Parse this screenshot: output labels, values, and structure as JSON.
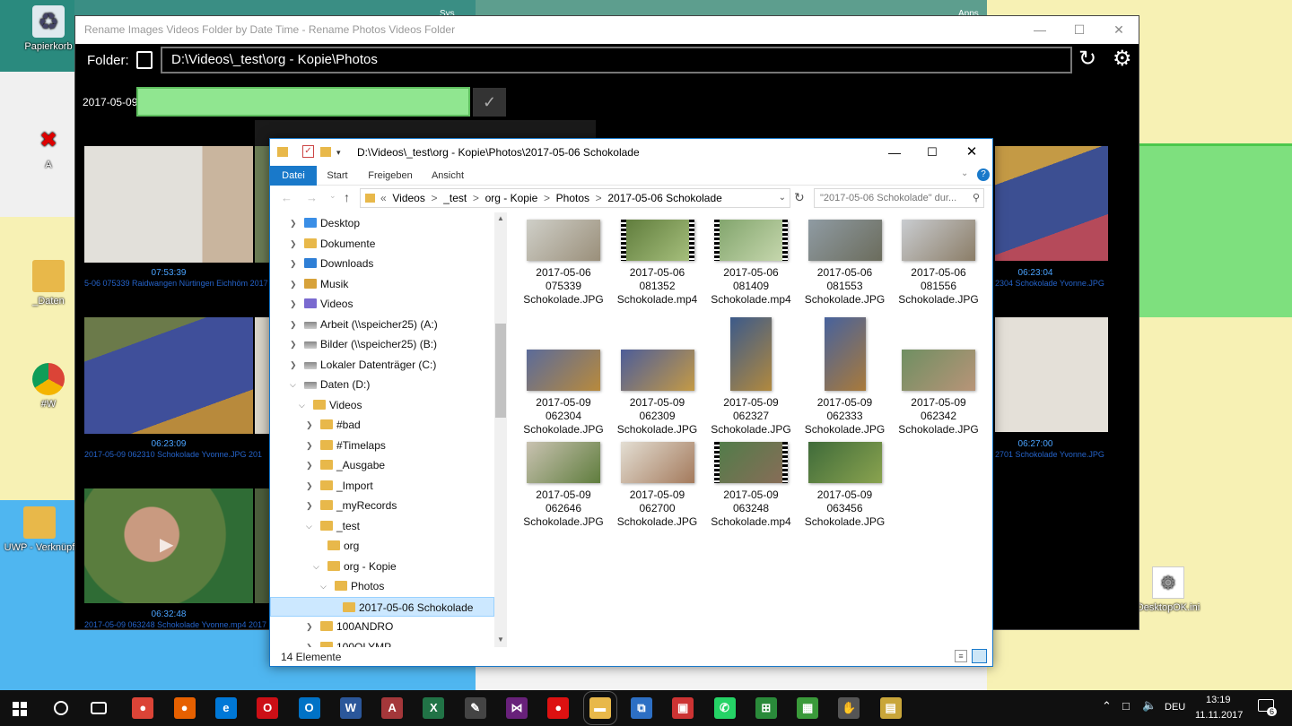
{
  "desktop": {
    "icons": [
      {
        "label": "Papierkorb",
        "icon": "recycle-bin-icon",
        "glyph": "🗑"
      },
      {
        "label": "A",
        "icon": "disconnected-drive-icon",
        "glyph": "🖥"
      },
      {
        "label": "_Daten",
        "icon": "folder-shortcut-icon",
        "glyph": "📁"
      },
      {
        "label": "#W",
        "icon": "chrome-shortcut-icon",
        "glyph": "🌐"
      },
      {
        "label": "UWP - Verknüpf",
        "icon": "folder-shortcut-icon",
        "glyph": "📁"
      },
      {
        "label": "DesktopOK.ini",
        "icon": "settings-file-icon",
        "glyph": "⚙"
      }
    ],
    "tile_text": [
      "Sys",
      "Apps"
    ]
  },
  "app": {
    "title": "Rename Images Videos Folder by Date Time - Rename Photos Videos Folder",
    "folder_label": "Folder:",
    "folder_path": "D:\\Videos\\_test\\org - Kopie\\Photos",
    "date_label": "2017-05-09",
    "confirm_glyph": "✓",
    "refresh_glyph": "↻",
    "settings_glyph": "⚙",
    "thumbs": [
      {
        "time": "07:53:39",
        "name": "5-06 075339 Raidwangen Nürtingen Eichhöm 2017-"
      },
      {
        "time": "06:23:04",
        "name": "2304 Schokolade Yvonne.JPG"
      },
      {
        "time": "06:23:09",
        "name": "2017-05-09 062310 Schokolade Yvonne.JPG 201"
      },
      {
        "time": "06:27:00",
        "name": "2701 Schokolade Yvonne.JPG"
      },
      {
        "time": "06:32:48",
        "name": "2017-05-09 063248 Schokolade Yvonne.mp4 2017"
      }
    ]
  },
  "explorer": {
    "title_path": "D:\\Videos\\_test\\org - Kopie\\Photos\\2017-05-06 Schokolade",
    "tabs": [
      "Datei",
      "Start",
      "Freigeben",
      "Ansicht"
    ],
    "breadcrumb": [
      "«",
      "Videos",
      ">",
      "_test",
      ">",
      "org - Kopie",
      ">",
      "Photos",
      ">",
      "2017-05-06 Schokolade"
    ],
    "search_placeholder": "\"2017-05-06 Schokolade\" dur...",
    "status": "14 Elemente",
    "tree": [
      {
        "label": "Desktop",
        "indent": 0,
        "chev": ">",
        "icon": "desktop"
      },
      {
        "label": "Dokumente",
        "indent": 0,
        "chev": ">",
        "icon": "docs"
      },
      {
        "label": "Downloads",
        "indent": 0,
        "chev": ">",
        "icon": "down"
      },
      {
        "label": "Musik",
        "indent": 0,
        "chev": ">",
        "icon": "music"
      },
      {
        "label": "Videos",
        "indent": 0,
        "chev": ">",
        "icon": "video"
      },
      {
        "label": "Arbeit (\\\\speicher25) (A:)",
        "indent": 0,
        "chev": ">",
        "icon": "drive"
      },
      {
        "label": "Bilder (\\\\speicher25) (B:)",
        "indent": 0,
        "chev": ">",
        "icon": "drive"
      },
      {
        "label": "Lokaler Datenträger (C:)",
        "indent": 0,
        "chev": ">",
        "icon": "drive"
      },
      {
        "label": "Daten (D:)",
        "indent": 0,
        "chev": "v",
        "icon": "drive"
      },
      {
        "label": "Videos",
        "indent": 1,
        "chev": "v",
        "icon": "folder"
      },
      {
        "label": "#bad",
        "indent": 2,
        "chev": ">",
        "icon": "folder"
      },
      {
        "label": "#Timelaps",
        "indent": 2,
        "chev": ">",
        "icon": "folder"
      },
      {
        "label": "_Ausgabe",
        "indent": 2,
        "chev": ">",
        "icon": "folder"
      },
      {
        "label": "_Import",
        "indent": 2,
        "chev": ">",
        "icon": "folder"
      },
      {
        "label": "_myRecords",
        "indent": 2,
        "chev": ">",
        "icon": "folder"
      },
      {
        "label": "_test",
        "indent": 2,
        "chev": "v",
        "icon": "folder"
      },
      {
        "label": "org",
        "indent": 3,
        "chev": "",
        "icon": "folder"
      },
      {
        "label": "org - Kopie",
        "indent": 3,
        "chev": "v",
        "icon": "folder"
      },
      {
        "label": "Photos",
        "indent": 4,
        "chev": "v",
        "icon": "folder"
      },
      {
        "label": "2017-05-06 Schokolade",
        "indent": 5,
        "chev": "",
        "icon": "folder",
        "selected": true
      },
      {
        "label": "100ANDRO",
        "indent": 2,
        "chev": ">",
        "icon": "folder"
      },
      {
        "label": "100OLYMP",
        "indent": 2,
        "chev": ">",
        "icon": "folder"
      }
    ],
    "files": [
      {
        "l1": "2017-05-06",
        "l2": "075339",
        "l3": "Schokolade.JPG",
        "kind": "img",
        "c1": "#cfcfc8",
        "c2": "#9a8f7a"
      },
      {
        "l1": "2017-05-06",
        "l2": "081352",
        "l3": "Schokolade.mp4",
        "kind": "vid",
        "c1": "#5d7a3a",
        "c2": "#a9c27f"
      },
      {
        "l1": "2017-05-06",
        "l2": "081409",
        "l3": "Schokolade.mp4",
        "kind": "vid",
        "c1": "#7fa36a",
        "c2": "#c9d9b0"
      },
      {
        "l1": "2017-05-06",
        "l2": "081553",
        "l3": "Schokolade.JPG",
        "kind": "img",
        "c1": "#8f9ba3",
        "c2": "#6b6c5c"
      },
      {
        "l1": "2017-05-06",
        "l2": "081556",
        "l3": "Schokolade.JPG",
        "kind": "img",
        "c1": "#c9ccd0",
        "c2": "#8b7d67"
      },
      {
        "l1": "2017-05-09",
        "l2": "062304",
        "l3": "Schokolade.JPG",
        "kind": "img",
        "c1": "#5b6b9a",
        "c2": "#b88a3c"
      },
      {
        "l1": "2017-05-09",
        "l2": "062309",
        "l3": "Schokolade.JPG",
        "kind": "img",
        "c1": "#4d5d99",
        "c2": "#c49a45"
      },
      {
        "l1": "2017-05-09",
        "l2": "062327",
        "l3": "Schokolade.JPG",
        "kind": "tall",
        "c1": "#3c5a8a",
        "c2": "#b1893e"
      },
      {
        "l1": "2017-05-09",
        "l2": "062333",
        "l3": "Schokolade.JPG",
        "kind": "tall",
        "c1": "#47629d",
        "c2": "#a97a3a"
      },
      {
        "l1": "2017-05-09",
        "l2": "062342",
        "l3": "Schokolade.JPG",
        "kind": "img",
        "c1": "#6f8f62",
        "c2": "#b89478"
      },
      {
        "l1": "2017-05-09",
        "l2": "062646",
        "l3": "Schokolade.JPG",
        "kind": "img",
        "c1": "#c9c2b1",
        "c2": "#5f7d3d"
      },
      {
        "l1": "2017-05-09",
        "l2": "062700",
        "l3": "Schokolade.JPG",
        "kind": "img",
        "c1": "#e3ded3",
        "c2": "#a47a5c"
      },
      {
        "l1": "2017-05-09",
        "l2": "063248",
        "l3": "Schokolade.mp4",
        "kind": "vid",
        "c1": "#4f7d49",
        "c2": "#8a6c58"
      },
      {
        "l1": "2017-05-09",
        "l2": "063456",
        "l3": "Schokolade.JPG",
        "kind": "img",
        "c1": "#3f6b3a",
        "c2": "#8aa34f"
      }
    ]
  },
  "taskbar": {
    "lang": "DEU",
    "time": "13:19",
    "date": "11.11.2017",
    "notif_count": "6",
    "apps": [
      {
        "name": "task-view",
        "glyph": "▭",
        "color": "#101010"
      },
      {
        "name": "chrome",
        "glyph": "●",
        "color": "#db4437"
      },
      {
        "name": "firefox",
        "glyph": "●",
        "color": "#e66000"
      },
      {
        "name": "edge",
        "glyph": "e",
        "color": "#0078d7"
      },
      {
        "name": "opera",
        "glyph": "O",
        "color": "#cc0f16"
      },
      {
        "name": "outlook",
        "glyph": "O",
        "color": "#0072c6"
      },
      {
        "name": "word",
        "glyph": "W",
        "color": "#2b579a"
      },
      {
        "name": "access",
        "glyph": "A",
        "color": "#a4373a"
      },
      {
        "name": "excel",
        "glyph": "X",
        "color": "#217346"
      },
      {
        "name": "pen-tool",
        "glyph": "✎",
        "color": "#444"
      },
      {
        "name": "visual-studio",
        "glyph": "⋈",
        "color": "#68217a"
      },
      {
        "name": "record",
        "glyph": "●",
        "color": "#d11"
      },
      {
        "name": "file-explorer",
        "glyph": "▬",
        "color": "#e8b84a"
      },
      {
        "name": "network-app",
        "glyph": "⧉",
        "color": "#2d6fc4"
      },
      {
        "name": "window-app",
        "glyph": "▣",
        "color": "#c33"
      },
      {
        "name": "whatsapp",
        "glyph": "✆",
        "color": "#25d366"
      },
      {
        "name": "calc-app",
        "glyph": "⊞",
        "color": "#2a8a3a"
      },
      {
        "name": "chart-app",
        "glyph": "▦",
        "color": "#3a9a3a"
      },
      {
        "name": "hands-app",
        "glyph": "✋",
        "color": "#555"
      },
      {
        "name": "gallery-app",
        "glyph": "▤",
        "color": "#c9a63a"
      }
    ]
  }
}
